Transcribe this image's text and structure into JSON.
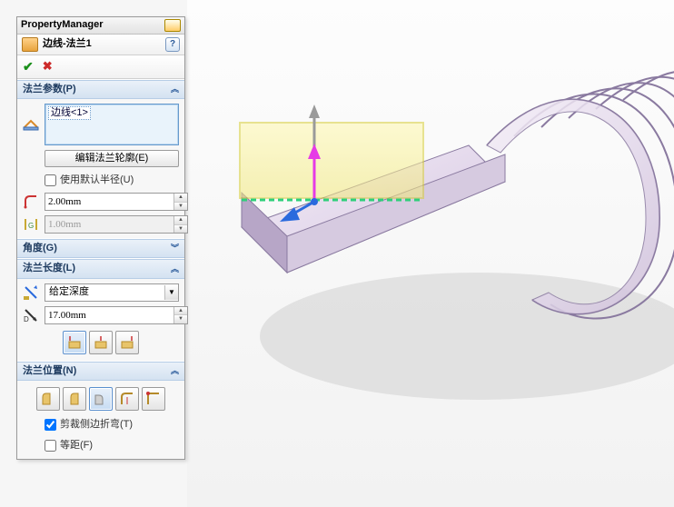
{
  "pm": {
    "title": "PropertyManager",
    "feature_icon": "edge-flange-icon",
    "feature_name": "边线-法兰1",
    "help": "?",
    "ok_icon": "ok-check-icon",
    "cancel_icon": "cancel-x-icon"
  },
  "params": {
    "header": "法兰参数(P)",
    "edge_icon": "edges-icon",
    "edges": [
      "边线<1>"
    ],
    "edit_profile_btn": "编辑法兰轮廓(E)",
    "use_default_radius": {
      "label": "使用默认半径(U)",
      "checked": false
    },
    "bend_radius_icon": "bend-radius-icon",
    "bend_radius": "2.00mm",
    "gap_icon": "gap-distance-icon",
    "gap": "1.00mm",
    "gap_enabled": false
  },
  "angle": {
    "header": "角度(G)"
  },
  "length": {
    "header": "法兰长度(L)",
    "end_icon": "end-condition-icon",
    "end_condition": "给定深度",
    "depth_icon": "depth-icon",
    "depth": "17.00mm",
    "option_icons": [
      "length-outer-icon",
      "length-inner-icon",
      "length-tangent-icon"
    ],
    "option_active": 0
  },
  "position": {
    "header": "法兰位置(N)",
    "option_icons": [
      "pos-material-inside-icon",
      "pos-material-outside-icon",
      "pos-bend-outside-icon",
      "pos-offset-icon",
      "pos-virtual-sharp-icon"
    ],
    "option_active": 2,
    "trim_side_bends": {
      "label": "剪裁侧边折弯(T)",
      "checked": true
    },
    "offset": {
      "label": "等距(F)",
      "checked": false
    }
  },
  "colors": {
    "panel_header_a": "#eaf1f9",
    "panel_header_b": "#d4e2f1",
    "accent": "#5a8fce"
  }
}
